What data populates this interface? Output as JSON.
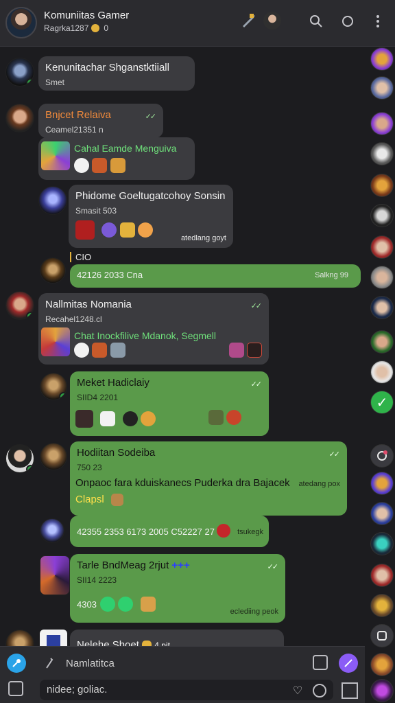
{
  "header": {
    "title": "Komuniitas Gamer",
    "subtitle": "Ragrka1287",
    "count": "0"
  },
  "messages": [
    {
      "name": "Kenunitachar Shganstktiiall",
      "sub": "Smet"
    },
    {
      "name": "Bnjcet Relaiva",
      "sub": "Ceamel21351 n",
      "line": "Cahal Eamde Menguiva"
    },
    {
      "name": "Phidome Goeltugatcohoy Sonsin",
      "sub": "Smasit 503",
      "stamp": "atedlang goyt"
    },
    {
      "reply_label": "CIO",
      "text": "42126 2033 Cna",
      "stamp": "Salkng 99"
    },
    {
      "name": "Nallmitas Nomania",
      "sub": "Recahel1248.cl",
      "line": "Chat Inockfilive Mdanok, Segmell"
    },
    {
      "name": "Meket Hadiclaiy",
      "sub": "SIID4 2201"
    },
    {
      "name": "Hodiitan Sodeiba",
      "sub": "750 23",
      "body": "Onpaoc fara kduiskanecs Puderka dra Bajacek",
      "yellow": "Clapsl",
      "stamp": "atedang pox"
    },
    {
      "text": "42355 2353 6173 2005 C52227 27",
      "stamp": "tsukegk"
    },
    {
      "name": "Tarle BndMeag 2rjut",
      "sub": "SII14 2223",
      "count": "4303",
      "stamp": "eclediing peok"
    },
    {
      "name": "Nelehe Shoet",
      "tail": "4 pit"
    }
  ],
  "composer": {
    "placeholder": "Namlatitca",
    "draft": "nidee; goliac."
  },
  "colors": {
    "bg": "#1c1c1f",
    "bubble_dark": "#3b3b3f",
    "bubble_green": "#5a9a4a",
    "accent_purple": "#8b5cf6",
    "accent_blue": "#2aa3e8"
  },
  "icons": [
    "search-icon",
    "refresh-icon",
    "more-icon",
    "send-icon",
    "attach-icon",
    "emoji-icon"
  ]
}
